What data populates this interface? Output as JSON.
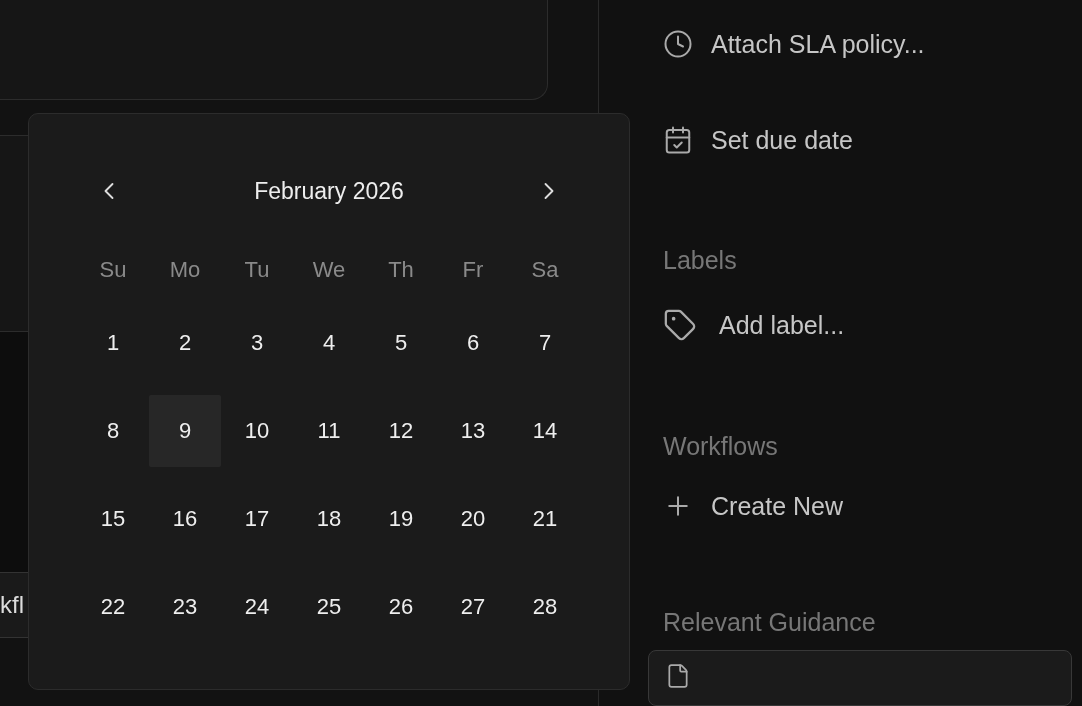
{
  "background": {
    "partial_button": {
      "label": "kfl"
    }
  },
  "date_picker": {
    "month": "February 2026",
    "weekdays": [
      "Su",
      "Mo",
      "Tu",
      "We",
      "Th",
      "Fr",
      "Sa"
    ],
    "days": [
      {
        "label": "1",
        "selected": false
      },
      {
        "label": "2",
        "selected": false
      },
      {
        "label": "3",
        "selected": false
      },
      {
        "label": "4",
        "selected": false
      },
      {
        "label": "5",
        "selected": false
      },
      {
        "label": "6",
        "selected": false
      },
      {
        "label": "7",
        "selected": false
      },
      {
        "label": "8",
        "selected": false
      },
      {
        "label": "9",
        "selected": true
      },
      {
        "label": "10",
        "selected": false
      },
      {
        "label": "11",
        "selected": false
      },
      {
        "label": "12",
        "selected": false
      },
      {
        "label": "13",
        "selected": false
      },
      {
        "label": "14",
        "selected": false
      },
      {
        "label": "15",
        "selected": false
      },
      {
        "label": "16",
        "selected": false
      },
      {
        "label": "17",
        "selected": false
      },
      {
        "label": "18",
        "selected": false
      },
      {
        "label": "19",
        "selected": false
      },
      {
        "label": "20",
        "selected": false
      },
      {
        "label": "21",
        "selected": false
      },
      {
        "label": "22",
        "selected": false
      },
      {
        "label": "23",
        "selected": false
      },
      {
        "label": "24",
        "selected": false
      },
      {
        "label": "25",
        "selected": false
      },
      {
        "label": "26",
        "selected": false
      },
      {
        "label": "27",
        "selected": false
      },
      {
        "label": "28",
        "selected": false
      }
    ]
  },
  "sidebar": {
    "items": [
      {
        "kind": "action",
        "label": "Attach SLA policy..."
      },
      {
        "kind": "action",
        "label": "Set due date"
      },
      {
        "kind": "heading",
        "label": "Labels"
      },
      {
        "kind": "action",
        "label": "Add label..."
      },
      {
        "kind": "heading",
        "label": "Workflows"
      },
      {
        "kind": "action",
        "label": "Create New"
      },
      {
        "kind": "heading",
        "label": "Relevant Guidance"
      },
      {
        "kind": "card"
      }
    ]
  }
}
